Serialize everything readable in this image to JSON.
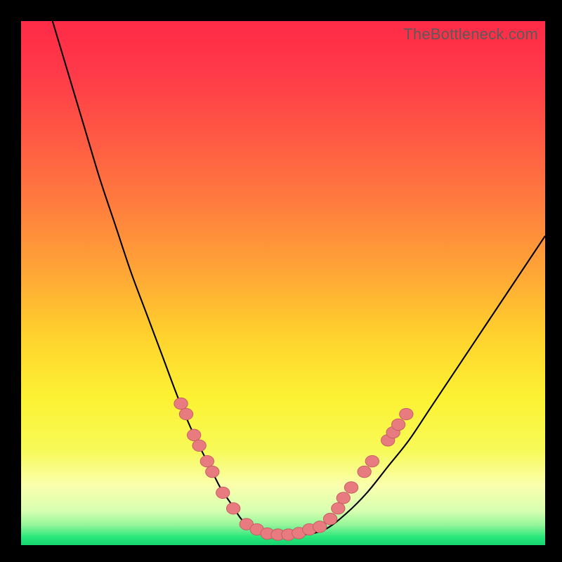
{
  "watermark": "TheBottleneck.com",
  "colors": {
    "frame": "#000000",
    "curve_stroke": "#000000",
    "marker_fill": "#e77b7f",
    "marker_stroke": "#c55a60",
    "green_band": "#27e77a"
  },
  "gradient_stops": [
    {
      "offset": 0.0,
      "color": "#ff2b48"
    },
    {
      "offset": 0.1,
      "color": "#ff3a49"
    },
    {
      "offset": 0.22,
      "color": "#ff5944"
    },
    {
      "offset": 0.35,
      "color": "#ff7d3e"
    },
    {
      "offset": 0.48,
      "color": "#ffa636"
    },
    {
      "offset": 0.6,
      "color": "#ffd22d"
    },
    {
      "offset": 0.72,
      "color": "#fcf233"
    },
    {
      "offset": 0.82,
      "color": "#f7fa58"
    },
    {
      "offset": 0.885,
      "color": "#fbffad"
    },
    {
      "offset": 0.935,
      "color": "#d7ffb0"
    },
    {
      "offset": 0.962,
      "color": "#93f59a"
    },
    {
      "offset": 0.985,
      "color": "#27e77a"
    },
    {
      "offset": 1.0,
      "color": "#16d46e"
    }
  ],
  "chart_data": {
    "type": "line",
    "title": "",
    "xlabel": "",
    "ylabel": "",
    "xlim": [
      0,
      100
    ],
    "ylim": [
      0,
      100
    ],
    "series": [
      {
        "name": "bottleneck-curve",
        "x": [
          6,
          9,
          12,
          15,
          18,
          21,
          24,
          27,
          30,
          33,
          36,
          38,
          40,
          42,
          44,
          47,
          50,
          54,
          58,
          62,
          66,
          70,
          74,
          78,
          82,
          86,
          90,
          94,
          98,
          100
        ],
        "y": [
          100,
          90,
          80,
          70,
          61,
          52,
          44,
          36,
          28,
          21,
          15,
          11,
          8,
          5,
          3,
          2,
          2,
          2,
          3,
          6,
          10,
          15,
          20,
          26,
          32,
          38,
          44,
          50,
          56,
          59
        ]
      }
    ],
    "markers": {
      "name": "highlighted-points",
      "points": [
        {
          "x": 30.5,
          "y": 27
        },
        {
          "x": 31.5,
          "y": 25
        },
        {
          "x": 33.0,
          "y": 21
        },
        {
          "x": 34.0,
          "y": 19
        },
        {
          "x": 35.5,
          "y": 16
        },
        {
          "x": 36.5,
          "y": 14
        },
        {
          "x": 38.5,
          "y": 10
        },
        {
          "x": 40.5,
          "y": 7
        },
        {
          "x": 43.0,
          "y": 4
        },
        {
          "x": 45.0,
          "y": 3
        },
        {
          "x": 47.0,
          "y": 2.2
        },
        {
          "x": 49.0,
          "y": 2
        },
        {
          "x": 51.0,
          "y": 2
        },
        {
          "x": 53.0,
          "y": 2.3
        },
        {
          "x": 55.0,
          "y": 3
        },
        {
          "x": 57.0,
          "y": 3.5
        },
        {
          "x": 59.0,
          "y": 5
        },
        {
          "x": 60.5,
          "y": 7
        },
        {
          "x": 61.5,
          "y": 9
        },
        {
          "x": 63.0,
          "y": 11
        },
        {
          "x": 65.5,
          "y": 14
        },
        {
          "x": 67.0,
          "y": 16
        },
        {
          "x": 70.0,
          "y": 20
        },
        {
          "x": 71.0,
          "y": 21.5
        },
        {
          "x": 72.0,
          "y": 23
        },
        {
          "x": 73.5,
          "y": 25
        }
      ]
    }
  }
}
